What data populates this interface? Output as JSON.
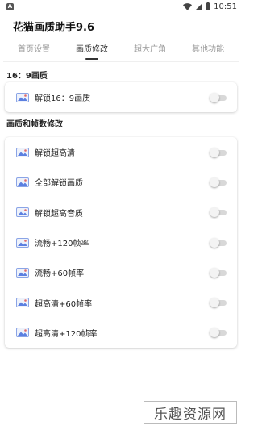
{
  "status_bar": {
    "time": "10:51",
    "badge": "A"
  },
  "app": {
    "title": "花猫画质助手9.6"
  },
  "tabs": [
    {
      "label": "首页设置",
      "active": false
    },
    {
      "label": "画质修改",
      "active": true
    },
    {
      "label": "超大广角",
      "active": false
    },
    {
      "label": "其他功能",
      "active": false
    }
  ],
  "section1": {
    "title": "16：9画质",
    "items": [
      {
        "label": "解锁16：9画质",
        "enabled": false
      }
    ]
  },
  "section2": {
    "title": "画质和帧数修改",
    "items": [
      {
        "label": "解锁超高清",
        "enabled": false
      },
      {
        "label": "全部解锁画质",
        "enabled": false
      },
      {
        "label": "解锁超高音质",
        "enabled": false
      },
      {
        "label": "流畅+120帧率",
        "enabled": false
      },
      {
        "label": "流畅+60帧率",
        "enabled": false
      },
      {
        "label": "超高清+60帧率",
        "enabled": false
      },
      {
        "label": "超高清+120帧率",
        "enabled": false
      }
    ]
  },
  "watermark": {
    "text": "乐趣资源网"
  },
  "colors": {
    "accent": "#333333",
    "switch_track": "#d8d8d8",
    "switch_thumb": "#f3f3f3",
    "icon_blue": "#5b7fe0"
  }
}
